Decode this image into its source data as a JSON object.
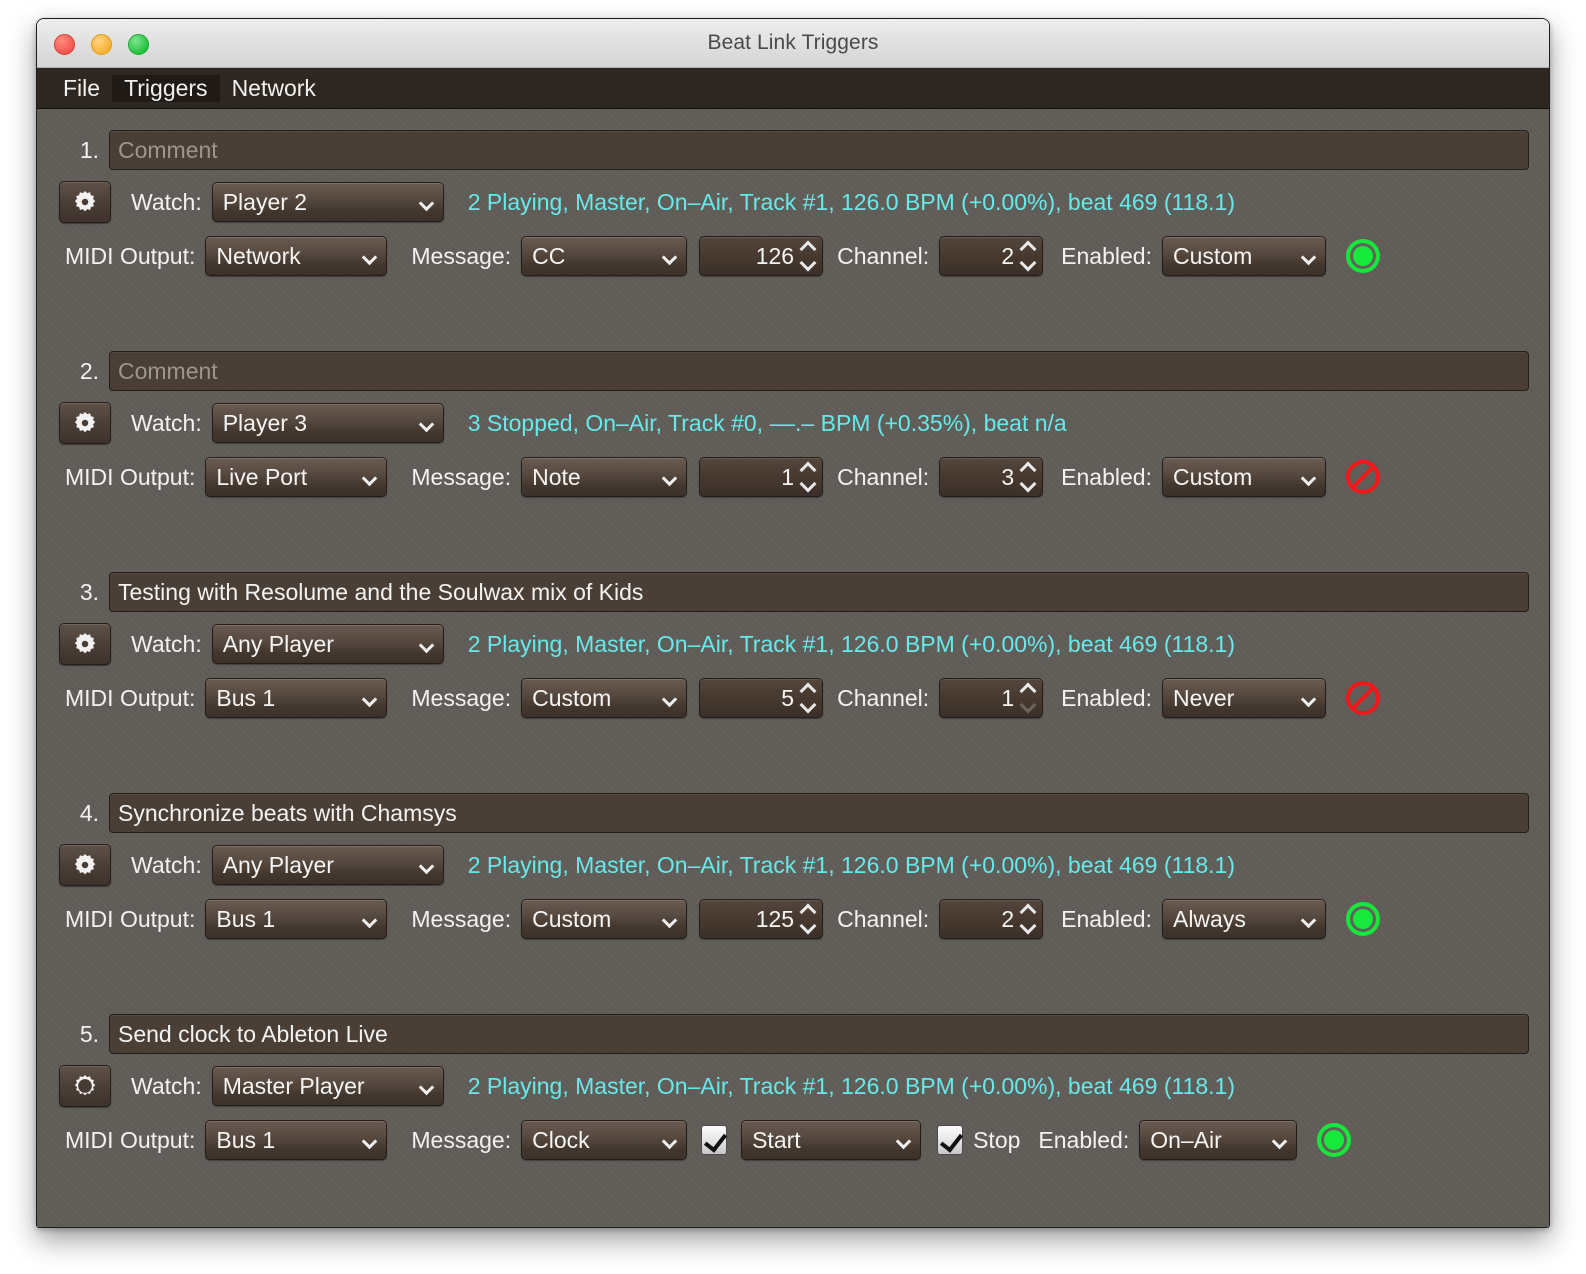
{
  "window": {
    "title": "Beat Link Triggers",
    "traffic_lights": [
      "close",
      "minimize",
      "maximize"
    ]
  },
  "menubar": {
    "items": [
      {
        "label": "File",
        "highlighted": false
      },
      {
        "label": "Triggers",
        "highlighted": true
      },
      {
        "label": "Network",
        "highlighted": false
      }
    ]
  },
  "labels": {
    "watch": "Watch:",
    "midi_output": "MIDI Output:",
    "message": "Message:",
    "channel": "Channel:",
    "enabled": "Enabled:",
    "stop": "Stop",
    "comment_placeholder": "Comment"
  },
  "colors": {
    "status_text": "#66e9ea",
    "enabled_lamp": "#17e83c",
    "disabled_lamp": "#f01818",
    "window_background": "#63605b",
    "menubar_background": "#2e2721",
    "field_background": "#493f37"
  },
  "triggers": [
    {
      "index": "1.",
      "comment": "",
      "comment_is_placeholder": true,
      "gear_icon": "gear-filled-icon",
      "watch": "Player 2",
      "status": "2 Playing, Master, On–Air, Track #1, 126.0 BPM (+0.00%), beat 469 (118.1)",
      "midi_output": "Network",
      "message": "CC",
      "note_value": "126",
      "channel": "2",
      "channel_down_disabled": false,
      "enabled": "Custom",
      "indicator": "on"
    },
    {
      "index": "2.",
      "comment": "",
      "comment_is_placeholder": true,
      "gear_icon": "gear-filled-icon",
      "watch": "Player 3",
      "status": "3 Stopped, On–Air, Track #0, ––.– BPM (+0.35%), beat n/a",
      "midi_output": "Live Port",
      "message": "Note",
      "note_value": "1",
      "channel": "3",
      "channel_down_disabled": false,
      "enabled": "Custom",
      "indicator": "off"
    },
    {
      "index": "3.",
      "comment": "Testing with Resolume and the Soulwax mix of Kids",
      "comment_is_placeholder": false,
      "gear_icon": "gear-filled-icon",
      "watch": "Any Player",
      "status": "2 Playing, Master, On–Air, Track #1, 126.0 BPM (+0.00%), beat 469 (118.1)",
      "midi_output": "Bus 1",
      "message": "Custom",
      "note_value": "5",
      "channel": "1",
      "channel_down_disabled": true,
      "enabled": "Never",
      "indicator": "off"
    },
    {
      "index": "4.",
      "comment": "Synchronize beats with Chamsys",
      "comment_is_placeholder": false,
      "gear_icon": "gear-filled-icon",
      "watch": "Any Player",
      "status": "2 Playing, Master, On–Air, Track #1, 126.0 BPM (+0.00%), beat 469 (118.1)",
      "midi_output": "Bus 1",
      "message": "Custom",
      "note_value": "125",
      "channel": "2",
      "channel_down_disabled": false,
      "enabled": "Always",
      "indicator": "on"
    },
    {
      "index": "5.",
      "comment": "Send clock to Ableton Live",
      "comment_is_placeholder": false,
      "gear_icon": "gear-outline-icon",
      "watch": "Master Player",
      "status": "2 Playing, Master, On–Air, Track #1, 126.0 BPM (+0.00%), beat 469 (118.1)",
      "midi_output": "Bus 1",
      "message": "Clock",
      "clock_mode": true,
      "start_checked": true,
      "start_option": "Start",
      "stop_checked": true,
      "stop_label": "Stop",
      "enabled": "On–Air",
      "indicator": "on"
    }
  ]
}
